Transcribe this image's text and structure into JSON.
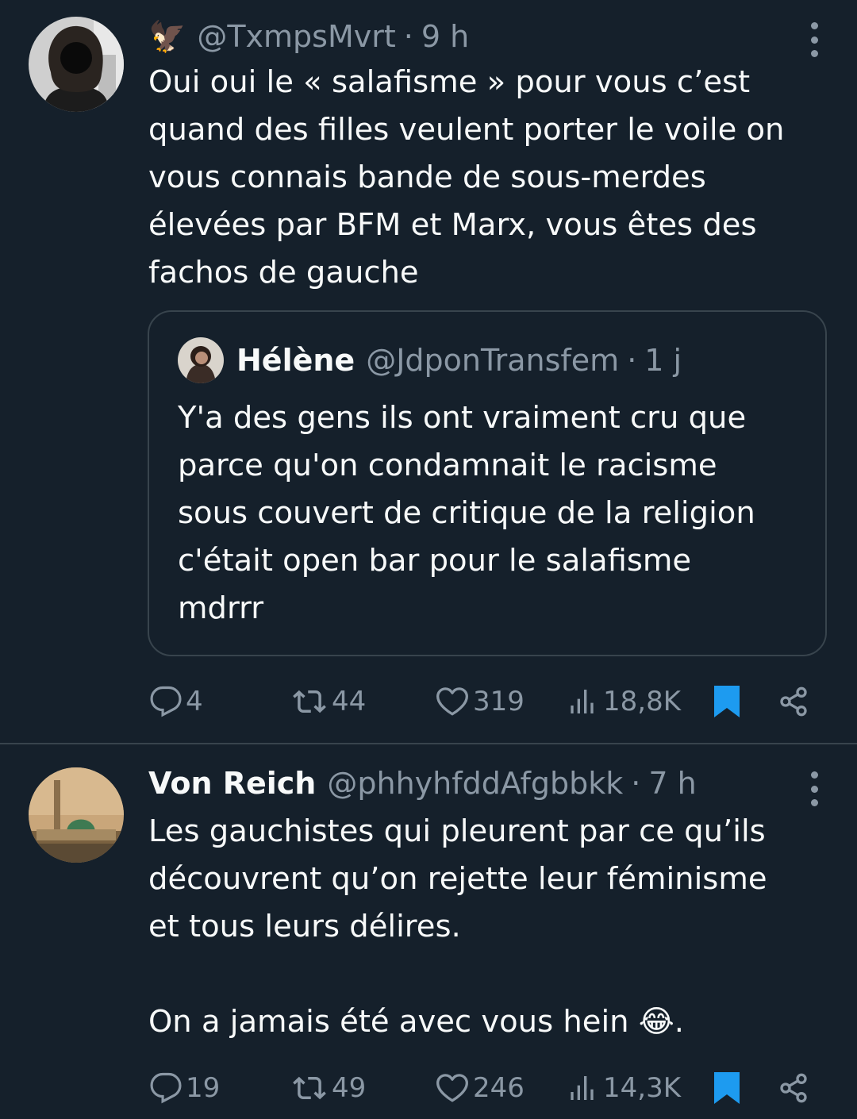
{
  "tweets": [
    {
      "name": "",
      "emoji": "🦅",
      "handle": "@TxmpsMvrt",
      "separator": "·",
      "time": "9 h",
      "text": "Oui oui le « salafisme » pour vous c’est\nquand des filles veulent porter le voile on\nvous connais bande de sous-merdes\nélevées par BFM et Marx, vous êtes des\nfachos de gauche",
      "quote": {
        "name": "Hélène",
        "handle": "@JdponTransfem",
        "separator": "·",
        "time": "1 j",
        "text": "Y'a des gens ils ont vraiment cru que\nparce qu'on condamnait le racisme\nsous couvert de critique de la religion\nc'était open bar pour le salafisme\nmdrrr"
      },
      "stats": {
        "replies": "4",
        "retweets": "44",
        "likes": "319",
        "views": "18,8K"
      },
      "bookmarked": true
    },
    {
      "name": "Von Reich",
      "handle": "@phhyhfddAfgbbkk",
      "separator": "·",
      "time": "7 h",
      "text": "Les gauchistes qui pleurent par ce qu’ils\ndécouvrent qu’on rejette leur féminisme\net tous leurs délires.\n\nOn a jamais été avec vous hein 😂.",
      "stats": {
        "replies": "19",
        "retweets": "49",
        "likes": "246",
        "views": "14,3K"
      },
      "bookmarked": true
    }
  ],
  "colors": {
    "background": "#15202b",
    "text": "#f7f9f9",
    "secondary": "#8b98a5",
    "border": "#38444d",
    "accent": "#1d9bf0"
  },
  "icons": [
    "more-icon",
    "reply-icon",
    "retweet-icon",
    "like-icon",
    "views-icon",
    "bookmark-icon",
    "share-icon"
  ]
}
